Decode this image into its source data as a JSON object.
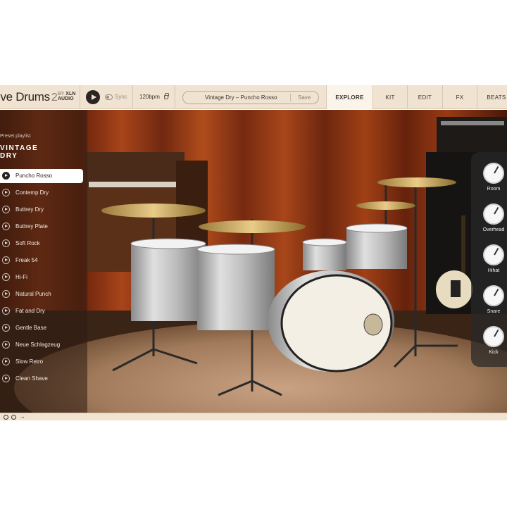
{
  "app": {
    "title": "ive Drums",
    "version": "2",
    "vendor_by": "BY",
    "vendor": "XLN",
    "vendor_sub": "AUDIO"
  },
  "transport": {
    "sync_label": "Sync",
    "tempo": "120bpm"
  },
  "preset_bar": {
    "current": "Vintage Dry – Puncho Rosso",
    "save_label": "Save"
  },
  "tabs": [
    {
      "label": "EXPLORE",
      "active": true
    },
    {
      "label": "KIT"
    },
    {
      "label": "EDIT"
    },
    {
      "label": "FX"
    },
    {
      "label": "BEATS"
    }
  ],
  "playlist": {
    "label": "Preset playlist",
    "title_line1": "VINTAGE",
    "title_line2": "DRY",
    "selected_index": 0,
    "items": [
      {
        "label": "Puncho Rosso"
      },
      {
        "label": "Contemp Dry"
      },
      {
        "label": "Buttrey Dry"
      },
      {
        "label": "Buttrey Plate"
      },
      {
        "label": "Soft Rock"
      },
      {
        "label": "Freak 54"
      },
      {
        "label": "Hi-Fi"
      },
      {
        "label": "Natural Punch"
      },
      {
        "label": "Fat and Dry"
      },
      {
        "label": "Gentle Base"
      },
      {
        "label": "Neue Schlagzeug"
      },
      {
        "label": "Slow Retro"
      },
      {
        "label": "Clean Shave"
      }
    ]
  },
  "mixer": {
    "channels": [
      {
        "label": "Room"
      },
      {
        "label": "Overhead"
      },
      {
        "label": "Hihat"
      },
      {
        "label": "Snare"
      },
      {
        "label": "Kick"
      }
    ]
  },
  "colors": {
    "toolbar": "#f0e3d1",
    "curtain": "#8a2e10",
    "text_dark": "#2a2520"
  }
}
